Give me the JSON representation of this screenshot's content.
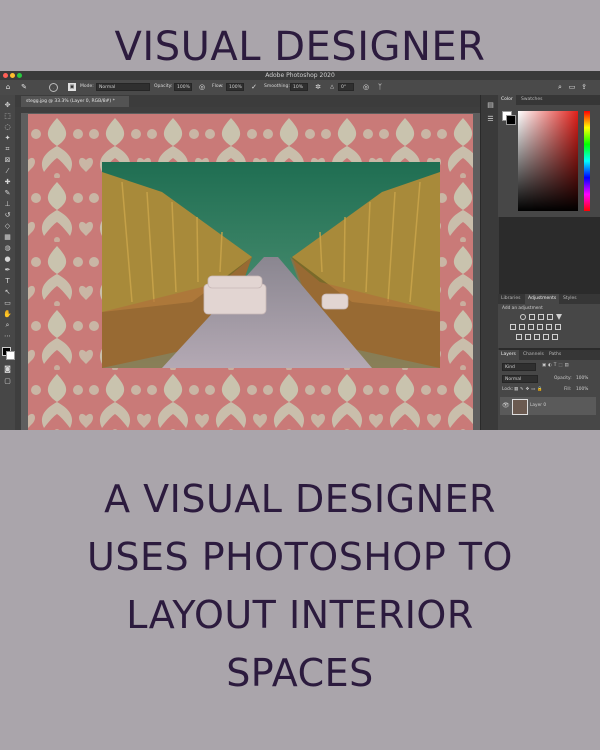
{
  "headline": "VISUAL DESIGNER",
  "caption_lines": [
    "A VISUAL DESIGNER",
    "USES PHOTOSHOP TO",
    "LAYOUT INTERIOR",
    "SPACES"
  ],
  "app": {
    "window_title": "Adobe Photoshop 2020",
    "options": {
      "mode_label": "Mode:",
      "mode_value": "Normal",
      "opacity_label": "Opacity:",
      "opacity_value": "100%",
      "flow_label": "Flow:",
      "flow_value": "100%",
      "smoothing_label": "Smoothing:",
      "smoothing_value": "10%",
      "angle_value": "0°"
    },
    "document_tab": "stegg.jpg @ 33.3% (Layer 0, RGB/8#) *",
    "color_panel_tabs": [
      "Color",
      "Swatches"
    ],
    "mid_panel_tabs": [
      "Libraries",
      "Adjustments",
      "Styles"
    ],
    "adjustments_hint": "Add an adjustment",
    "layers_tabs": [
      "Layers",
      "Channels",
      "Paths"
    ],
    "layers_filter": "Kind",
    "blend_mode": "Normal",
    "opacity_label": "Opacity:",
    "opacity_value": "100%",
    "lock_label": "Lock:",
    "fill_label": "Fill:",
    "fill_value": "100%",
    "layer_name": "Layer 0"
  },
  "colors": {
    "page_bg": "#aaa5ab",
    "headline_text": "#2c1b3e",
    "pattern_pink": "#c97a78",
    "pattern_light": "#c9d0b8"
  },
  "icons": [
    "home-icon",
    "brush-icon",
    "search-icon",
    "visibility-eye-icon",
    "workspace-icon"
  ]
}
